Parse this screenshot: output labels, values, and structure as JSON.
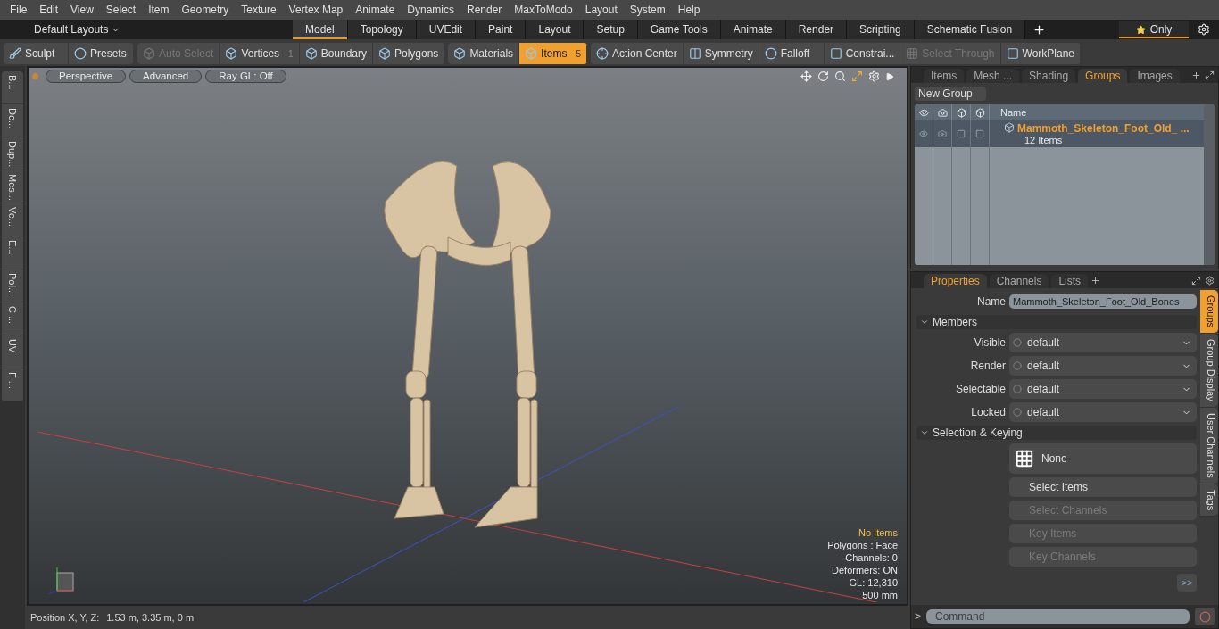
{
  "menu": [
    "File",
    "Edit",
    "View",
    "Select",
    "Item",
    "Geometry",
    "Texture",
    "Vertex Map",
    "Animate",
    "Dynamics",
    "Render",
    "MaxToModo",
    "Layout",
    "System",
    "Help"
  ],
  "layout_bar": {
    "layouts": "Default Layouts",
    "tabs": [
      {
        "label": "Model",
        "selected": true
      },
      {
        "label": "Topology",
        "selected": false
      },
      {
        "label": "UVEdit",
        "selected": false
      },
      {
        "label": "Paint",
        "selected": false
      },
      {
        "label": "Layout",
        "selected": false
      },
      {
        "label": "Setup",
        "selected": false
      },
      {
        "label": "Game Tools",
        "selected": false
      },
      {
        "label": "Animate",
        "selected": false
      },
      {
        "label": "Render",
        "selected": false
      },
      {
        "label": "Scripting",
        "selected": false
      },
      {
        "label": "Schematic Fusion",
        "selected": false
      }
    ],
    "only": "Only"
  },
  "toolbar": {
    "groups": [
      [
        {
          "label": "Sculpt",
          "disabled": false,
          "selected": false
        },
        {
          "label": "Presets",
          "disabled": false,
          "selected": false
        }
      ],
      [
        {
          "label": "Auto Select",
          "disabled": true,
          "selected": false
        },
        {
          "label": "Vertices",
          "count": "1",
          "disabled": false,
          "selected": false
        },
        {
          "label": "Boundary",
          "disabled": false,
          "selected": false
        },
        {
          "label": "Polygons",
          "disabled": false,
          "selected": false
        }
      ],
      [
        {
          "label": "Materials",
          "disabled": false,
          "selected": false
        },
        {
          "label": "Items",
          "count": "5",
          "disabled": false,
          "selected": true
        }
      ],
      [
        {
          "label": "Action Center",
          "disabled": false,
          "selected": false
        },
        {
          "label": "Symmetry",
          "disabled": false,
          "selected": false
        },
        {
          "label": "Falloff",
          "disabled": false,
          "selected": false
        },
        {
          "label": "Constrai...",
          "disabled": false,
          "selected": false
        },
        {
          "label": "Select Through",
          "disabled": true,
          "selected": false
        },
        {
          "label": "WorkPlane",
          "disabled": false,
          "selected": false
        }
      ]
    ]
  },
  "left_strip": [
    "B...",
    "De...",
    "Dup...",
    "Mes...",
    "Ve...",
    "E...",
    "Pol...",
    "C ...",
    "UV",
    "F ..."
  ],
  "viewport": {
    "buttons": [
      "Perspective",
      "Advanced",
      "Ray GL: Off"
    ],
    "info": [
      {
        "text": "No Items",
        "highlight": true
      },
      {
        "text": "Polygons : Face",
        "highlight": false
      },
      {
        "text": "Channels: 0",
        "highlight": false
      },
      {
        "text": "Deformers: ON",
        "highlight": false
      },
      {
        "text": "GL: 12,310",
        "highlight": false
      },
      {
        "text": "500 mm",
        "highlight": false
      }
    ]
  },
  "status_bar": {
    "label": "Position X, Y, Z:",
    "value": "1.53 m, 3.35 m, 0 m"
  },
  "groups_panel": {
    "tabs": [
      {
        "label": "Items",
        "selected": false
      },
      {
        "label": "Mesh ...",
        "selected": false
      },
      {
        "label": "Shading",
        "selected": false
      },
      {
        "label": "Groups",
        "selected": true
      },
      {
        "label": "Images",
        "selected": false
      }
    ],
    "new_group": "New Group",
    "column": "Name",
    "rows": [
      {
        "name": "Mammoth_Skeleton_Foot_Old_ ...",
        "count": "12 Items",
        "selected": true
      }
    ]
  },
  "properties": {
    "tabs": [
      {
        "label": "Properties",
        "selected": true
      },
      {
        "label": "Channels",
        "selected": false
      },
      {
        "label": "Lists",
        "selected": false
      }
    ],
    "name_label": "Name",
    "name_value": "Mammoth_Skeleton_Foot_Old_Bones",
    "members_title": "Members",
    "members": [
      {
        "label": "Visible",
        "value": "default"
      },
      {
        "label": "Render",
        "value": "default"
      },
      {
        "label": "Selectable",
        "value": "default"
      },
      {
        "label": "Locked",
        "value": "default"
      }
    ],
    "keying_title": "Selection & Keying",
    "mode": "None",
    "buttons": [
      {
        "label": "Select Items",
        "disabled": false
      },
      {
        "label": "Select Channels",
        "disabled": true
      },
      {
        "label": "Key Items",
        "disabled": true
      },
      {
        "label": "Key Channels",
        "disabled": true
      }
    ],
    "more": ">>",
    "side_tabs": [
      {
        "label": "Groups",
        "selected": true
      },
      {
        "label": "Group Display",
        "selected": false
      },
      {
        "label": "User Channels",
        "selected": false
      },
      {
        "label": "Tags",
        "selected": false
      }
    ],
    "command_placeholder": "Command",
    "prompt": ">"
  }
}
